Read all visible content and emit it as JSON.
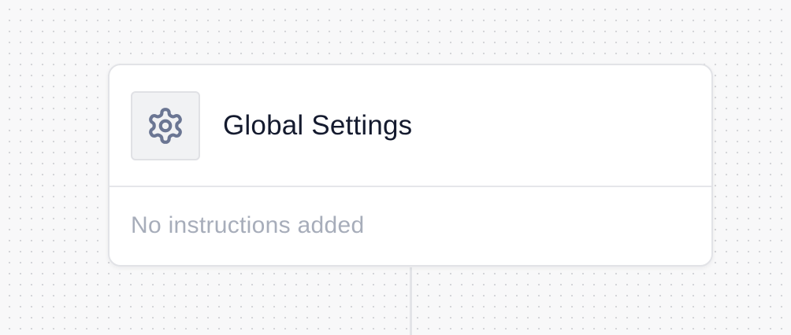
{
  "node": {
    "icon": "gear-icon",
    "title": "Global Settings",
    "instructions_text": "No instructions added"
  },
  "colors": {
    "canvas_background": "#f8f8f9",
    "canvas_dot": "#d2d3d7",
    "card_background": "#ffffff",
    "card_border": "#e2e3e7",
    "icon_box_background": "#f1f2f4",
    "icon_stroke": "#6b7693",
    "title_text": "#141a2e",
    "muted_text": "#a7adba",
    "connector": "#e3e4e8"
  }
}
